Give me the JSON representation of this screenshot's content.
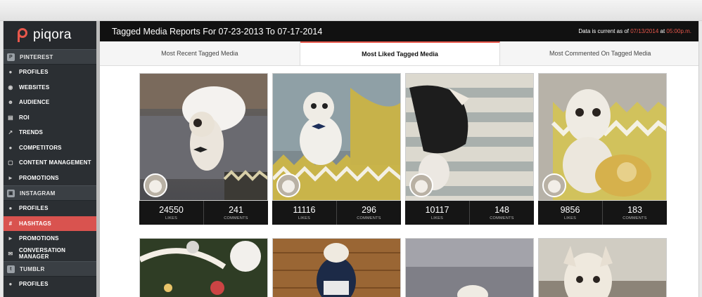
{
  "app": {
    "logo_text": "piqora"
  },
  "header": {
    "title": "Tagged Media Reports For 07-23-2013 To 07-17-2014",
    "status_prefix": "Data is current as of",
    "status_date": "07/13/2014",
    "status_mid": "at",
    "status_time": "05:00p.m."
  },
  "sidebar": {
    "sections": [
      {
        "label": "PINTEREST",
        "icon": "pinterest-icon"
      },
      {
        "label": "INSTAGRAM",
        "icon": "instagram-icon"
      },
      {
        "label": "TUMBLR",
        "icon": "tumblr-icon"
      }
    ],
    "pinterest_items": [
      {
        "label": "PROFILES",
        "icon": "profile-icon"
      },
      {
        "label": "WEBSITES",
        "icon": "globe-icon"
      },
      {
        "label": "AUDIENCE",
        "icon": "audience-icon"
      },
      {
        "label": "ROI",
        "icon": "roi-chart-icon"
      },
      {
        "label": "TRENDS",
        "icon": "trends-icon"
      },
      {
        "label": "COMPETITORS",
        "icon": "competitors-icon"
      },
      {
        "label": "CONTENT MANAGEMENT",
        "icon": "content-icon"
      },
      {
        "label": "PROMOTIONS",
        "icon": "megaphone-icon"
      }
    ],
    "instagram_items": [
      {
        "label": "PROFILES",
        "icon": "profile-icon"
      },
      {
        "label": "HASHTAGS",
        "icon": "hashtag-icon",
        "active": true
      },
      {
        "label": "PROMOTIONS",
        "icon": "megaphone-icon"
      },
      {
        "label": "CONVERSATION MANAGER",
        "icon": "chat-icon"
      }
    ],
    "tumblr_items": [
      {
        "label": "PROFILES",
        "icon": "profile-icon"
      }
    ]
  },
  "tabs": [
    {
      "label": "Most Recent Tagged Media"
    },
    {
      "label": "Most Liked Tagged Media",
      "active": true
    },
    {
      "label": "Most Commented On Tagged Media"
    }
  ],
  "stat_labels": {
    "likes": "LIKES",
    "comments": "COMMENTS"
  },
  "media": [
    {
      "likes": "24550",
      "comments": "241"
    },
    {
      "likes": "11116",
      "comments": "296"
    },
    {
      "likes": "10117",
      "comments": "148"
    },
    {
      "likes": "9856",
      "comments": "183"
    }
  ],
  "colors": {
    "accent": "#e8574b",
    "sidebar": "#2b2f33",
    "active_item": "#d9534f",
    "header": "#111111"
  }
}
